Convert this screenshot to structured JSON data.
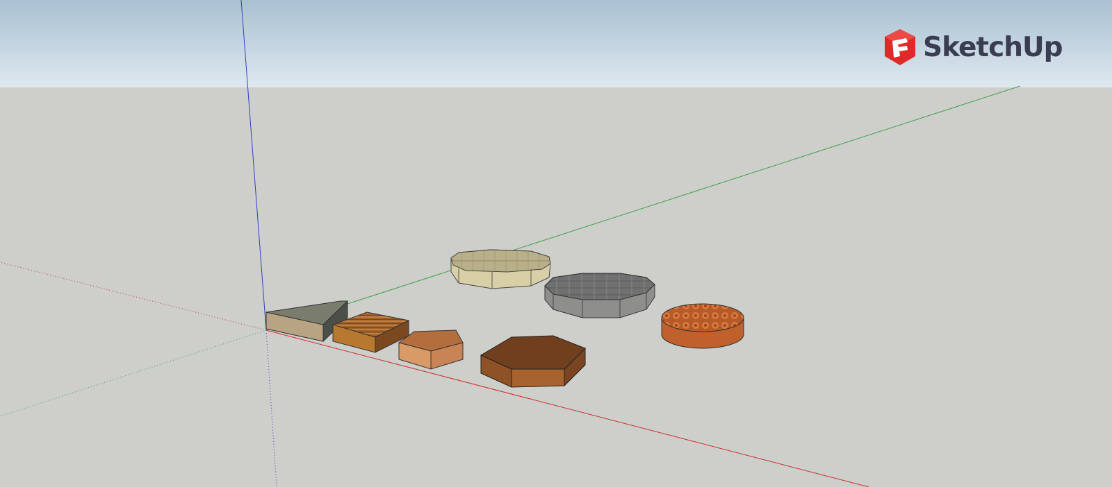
{
  "app": {
    "brand_name": "SketchUp",
    "logo_icon": "sketchup-logo-icon"
  },
  "viewport": {
    "sky_color_top": "#a9c1d2",
    "sky_color_bottom": "#dfe8ef",
    "ground_color": "#cececa",
    "axis_colors": {
      "red": "#c9302c",
      "green": "#3aa34a",
      "blue": "#2e3fc8"
    }
  },
  "models": [
    {
      "name": "triangular-prism",
      "material": "stone-wood"
    },
    {
      "name": "square-block",
      "material": "striped-wood"
    },
    {
      "name": "pentagon-block",
      "material": "light-wood"
    },
    {
      "name": "hexagon-block",
      "material": "dark-wood"
    },
    {
      "name": "octagon-block",
      "material": "beige-stone"
    },
    {
      "name": "dodecagon-block",
      "material": "grey-slate"
    },
    {
      "name": "round-block",
      "material": "terracotta-roof-tile"
    }
  ],
  "brand_colors": {
    "logo_red": "#e02a2a",
    "text": "#3a3d52"
  }
}
